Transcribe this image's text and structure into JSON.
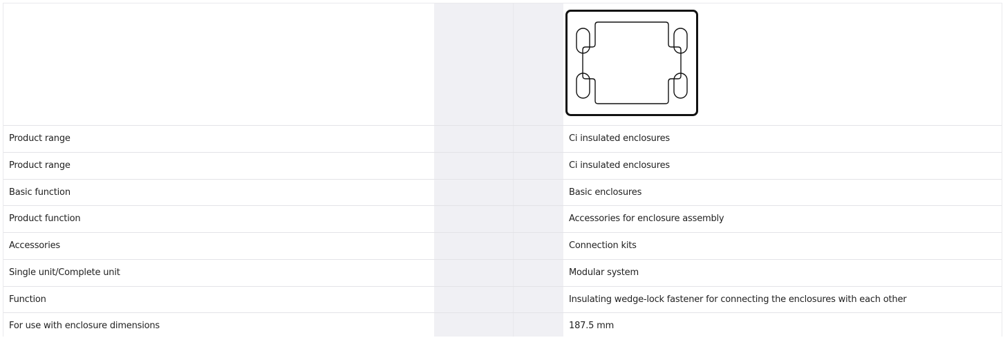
{
  "product_image": {
    "icon": "enclosure-connection-kit-drawing",
    "stroke_color": "#111111"
  },
  "attributes": [
    {
      "label": "Product range",
      "value": "Ci insulated enclosures"
    },
    {
      "label": "Product range",
      "value": "Ci insulated enclosures"
    },
    {
      "label": "Basic function",
      "value": "Basic enclosures"
    },
    {
      "label": "Product function",
      "value": "Accessories for enclosure assembly"
    },
    {
      "label": "Accessories",
      "value": "Connection kits"
    },
    {
      "label": "Single unit/Complete unit",
      "value": "Modular system"
    },
    {
      "label": "Function",
      "value": "Insulating wedge-lock fastener for connecting the enclosures with each other"
    },
    {
      "label": "For use with enclosure dimensions",
      "value": "187.5 mm"
    }
  ]
}
